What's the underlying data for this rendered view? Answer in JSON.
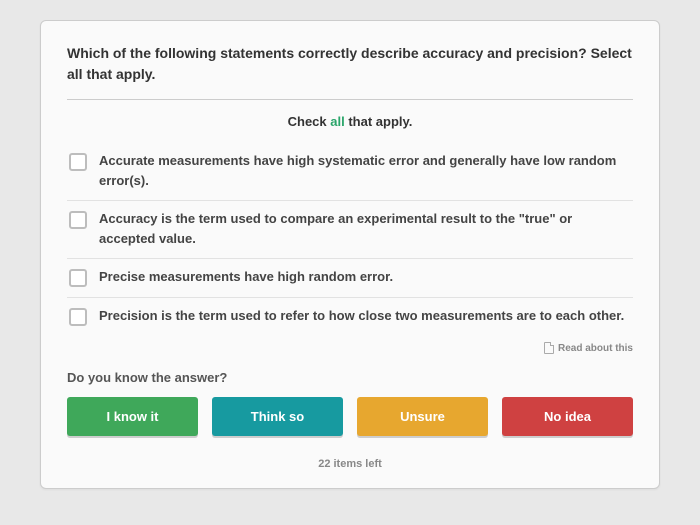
{
  "question": "Which of the following statements correctly describe accuracy and precision? Select all that apply.",
  "instruction_prefix": "Check ",
  "instruction_all": "all",
  "instruction_suffix": " that apply.",
  "options": [
    "Accurate measurements have high systematic error and generally have low random error(s).",
    "Accuracy is the term used to compare an experimental result to the \"true\" or accepted value.",
    "Precise measurements have high random error.",
    "Precision is the term used to refer to how close two measurements are to each other."
  ],
  "read_about": "Read about this",
  "prompt": "Do you know the answer?",
  "buttons": {
    "know": "I know it",
    "think": "Think so",
    "unsure": "Unsure",
    "noidea": "No idea"
  },
  "footer": "22 items left"
}
